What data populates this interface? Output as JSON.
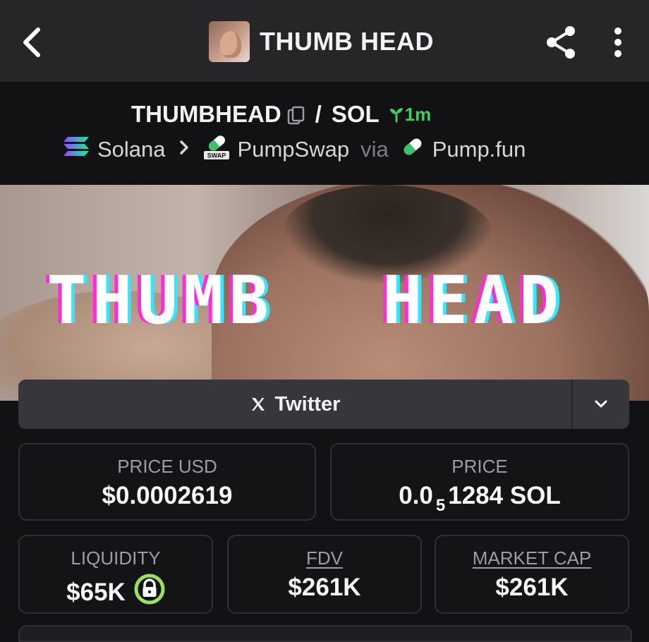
{
  "header": {
    "title": "THUMB HEAD"
  },
  "pair": {
    "base": "THUMBHEAD",
    "quote": "SOL",
    "age": "1m",
    "chain": "Solana",
    "dex": "PumpSwap",
    "dex_badge": "SWAP",
    "via_label": "via",
    "launchpad": "Pump.fun"
  },
  "banner": {
    "word1": "THUMB",
    "word2": "HEAD"
  },
  "socials": {
    "twitter_label": "Twitter"
  },
  "stats": {
    "price_usd_label": "PRICE USD",
    "price_usd_value": "$0.0002619",
    "price_label": "PRICE",
    "price_prefix": "0.0",
    "price_subscript": "5",
    "price_suffix": "1284 SOL",
    "liquidity_label": "LIQUIDITY",
    "liquidity_value": "$65K",
    "fdv_label": "FDV",
    "fdv_value": "$261K",
    "mcap_label": "MARKET CAP",
    "mcap_value": "$261K"
  },
  "colors": {
    "background": "#121214",
    "topbar": "#262629",
    "accent_green": "#3ecf5f",
    "lock_green": "#9be15d"
  }
}
